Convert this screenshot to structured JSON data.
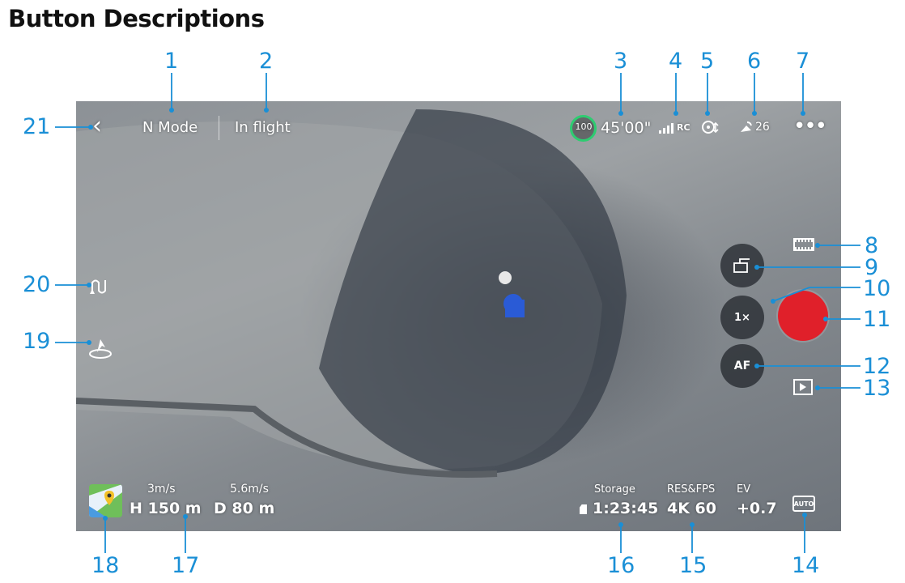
{
  "heading": "Button Descriptions",
  "callouts": [
    "1",
    "2",
    "3",
    "4",
    "5",
    "6",
    "7",
    "8",
    "9",
    "10",
    "11",
    "12",
    "13",
    "14",
    "15",
    "16",
    "17",
    "18",
    "19",
    "20",
    "21"
  ],
  "top_bar": {
    "flight_mode": "N Mode",
    "status": "In flight",
    "battery_percent": "100",
    "flight_time": "45'00\"",
    "rc_label": "RC",
    "gps_count": "26"
  },
  "right_panel": {
    "zoom_label": "1×",
    "focus_label": "AF"
  },
  "telemetry": {
    "vertical_speed": "3m/s",
    "height": "H 150 m",
    "horizontal_speed": "5.6m/s",
    "distance": "D 80 m"
  },
  "camera_params": {
    "storage_label": "Storage",
    "storage_value": "1:23:45",
    "resfps_label": "RES&FPS",
    "resfps_value": "4K 60",
    "ev_label": "EV",
    "ev_value": "+0.7",
    "camera_mode": "AUTO"
  },
  "colors": {
    "callout": "#1a8fd6",
    "record": "#e0202a",
    "battery_ring": "#2ecc71"
  }
}
